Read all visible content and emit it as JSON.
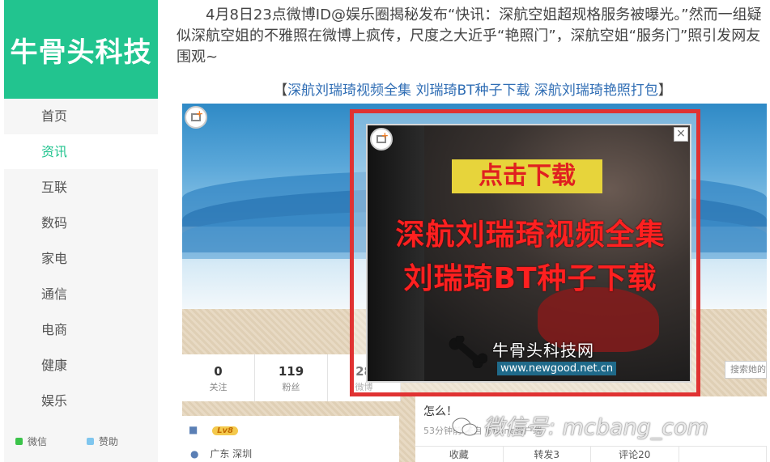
{
  "sidebar": {
    "logo": "牛骨头科技",
    "items": [
      {
        "label": "首页"
      },
      {
        "label": "资讯"
      },
      {
        "label": "互联"
      },
      {
        "label": "数码"
      },
      {
        "label": "家电"
      },
      {
        "label": "通信"
      },
      {
        "label": "电商"
      },
      {
        "label": "健康"
      },
      {
        "label": "娱乐"
      }
    ],
    "active_item": "资讯",
    "footer": {
      "wechat": "微信",
      "donate": "赞助"
    }
  },
  "article": {
    "paragraph": "4月8日23点微博ID@娱乐圈揭秘发布“快讯：深航空姐超规格服务被曝光。”然而一组疑似深航空姐的不雅照在微博上疯传，尺度之大近乎“艳照门”，深航空姐“服务门”照引发网友围观~",
    "links": {
      "open": "【",
      "link1": "深航刘瑞琦视频全集",
      "link2": "刘瑞琦BT种子下载",
      "link3": "深航刘瑞琦艳照打包",
      "close": "】"
    }
  },
  "profile_screenshot": {
    "stats": [
      {
        "value": "0",
        "label": "关注"
      },
      {
        "value": "119",
        "label": "粉丝"
      },
      {
        "value": "28",
        "label": "微博"
      }
    ],
    "search_placeholder": "搜索她的",
    "level_badge": "Lv8",
    "location": "广东 深圳",
    "feed": {
      "title": "怎么！",
      "meta": "53分钟前 来自 iPhone客户端",
      "actions": [
        "收藏",
        "转发3",
        "评论20",
        ""
      ]
    }
  },
  "ad": {
    "button": "点击下载",
    "line1": "深航刘瑞琦视频全集",
    "line2": "刘瑞琦BT种子下载",
    "brand": "牛骨头科技网",
    "url": "www.newgood.net.cn",
    "close_glyph": "×"
  },
  "watermark": "微信号: mcbang_com",
  "colors": {
    "accent": "#22c48f",
    "link": "#2f6db4",
    "highlight_frame": "#e03232",
    "ad_text": "#ff2020",
    "ad_button": "#e7d43b"
  }
}
